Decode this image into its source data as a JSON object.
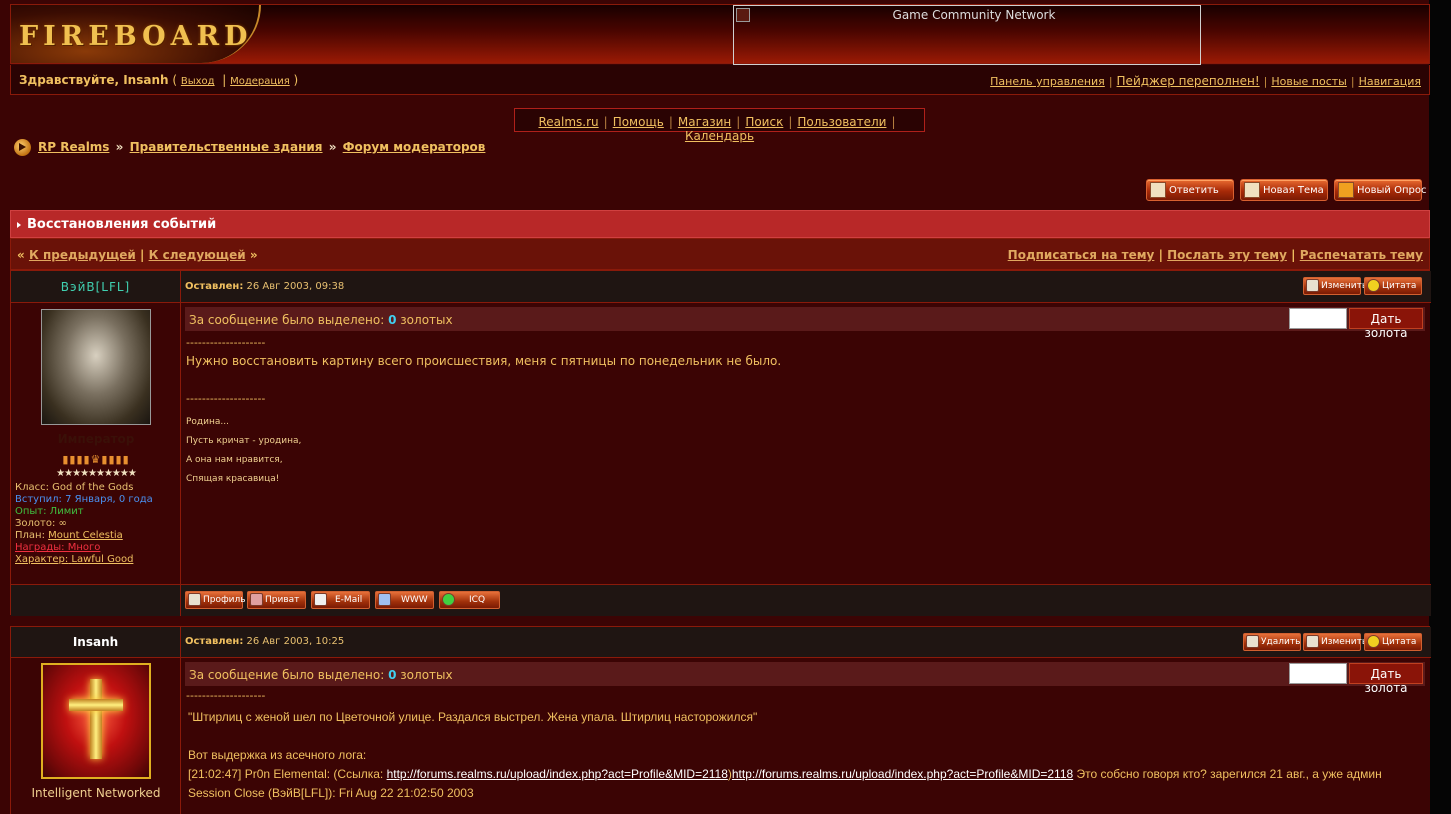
{
  "header": {
    "logo_text": "FIREBOARD",
    "banner_alt": "Game Community Network"
  },
  "userbar": {
    "greeting": "Здравствуйте, Insanh",
    "open_paren": " ( ",
    "logout": "Выход",
    "moderation": "Модерация",
    "close_paren": " )",
    "links": [
      "Панель управления",
      "Пейджер переполнен!",
      "Новые посты",
      "Навигация"
    ]
  },
  "nav": {
    "links": [
      "Realms.ru",
      "Помощь",
      "Магазин",
      "Поиск",
      "Пользователи",
      "Календарь"
    ]
  },
  "breadcrumb": [
    "RP Realms",
    "Правительственные здания",
    "Форум модераторов"
  ],
  "breadcrumb_sep": "»",
  "actions": {
    "reply": "Ответить",
    "new_topic": "Новая Тема",
    "new_poll": "Новый Опрос"
  },
  "topic": {
    "title": "Восстановления событий"
  },
  "pagebar": {
    "prev": "К предыдущей",
    "next": "К следующей",
    "subscribe": "Подписаться на тему",
    "send": "Послать эту тему",
    "print": "Распечатать тему",
    "sep": "|",
    "laquo": "«",
    "raquo": "»"
  },
  "posts": [
    {
      "author": "ВэйВ[LFL]",
      "date_label": "Оставлен:",
      "date": "26 Авг 2003, 09:38",
      "buttons": [
        "Изменить",
        "Цитата"
      ],
      "gold_text": "За сообщение было выделено:",
      "gold_value": "0",
      "gold_unit": "золотых",
      "gold_button": "Дать золота",
      "rank": "Император",
      "stars": "★★★★★★★★★★",
      "info": {
        "class_label": "Класс:",
        "class_value": "God of the Gods",
        "joined": "Вступил: 7 Января, 0 года",
        "exp": "Опыт: Лимит",
        "gold": "Золото: ∞",
        "plan_label": "План:",
        "plan_value": "Mount Celestia",
        "awards": "Награды: Много",
        "char_label": "Характер:",
        "char_value": "Lawful Good"
      },
      "divider": "--------------------",
      "message": "Нужно восстановить картину всего происшествия, меня с пятницы по понедельник не было.",
      "signature": [
        "Родина...",
        "Пусть кричат - уродина,",
        "А она нам нравится,",
        "Спящая красавица!"
      ],
      "footer_buttons": [
        "Профиль",
        "Приват",
        "E-Mail",
        "WWW",
        "ICQ"
      ]
    },
    {
      "author": "Insanh",
      "date_label": "Оставлен:",
      "date": "26 Авг 2003, 10:25",
      "buttons": [
        "Удалить",
        "Изменить",
        "Цитата"
      ],
      "gold_text": "За сообщение было выделено:",
      "gold_value": "0",
      "gold_unit": "золотых",
      "gold_button": "Дать золота",
      "rank": "Intelligent Networked",
      "divider": "--------------------",
      "quote": "\"Штирлиц с женой шел по Цветочной улице. Раздался выстрел. Жена упала. Штирлиц насторожился\"",
      "log_intro": "Вот выдержка из асечного лога:",
      "log_line_prefix": "[21:02:47] Pr0n Elemental: (Ссылка: ",
      "log_link1": "http://forums.realms.ru/upload/index.php?act=Profile&MID=2118",
      "log_mid": ")",
      "log_link2": "http://forums.realms.ru/upload/index.php?act=Profile&MID=2118",
      "log_suffix": " Это собсно говоря кто? зарегился 21 авг., а уже админ",
      "log_session": "Session Close (ВэйВ[LFL]): Fri Aug 22 21:02:50 2003"
    }
  ],
  "colors": {
    "author1": "#40d0b0",
    "accent": "#b82828",
    "text": "#f0c060"
  }
}
